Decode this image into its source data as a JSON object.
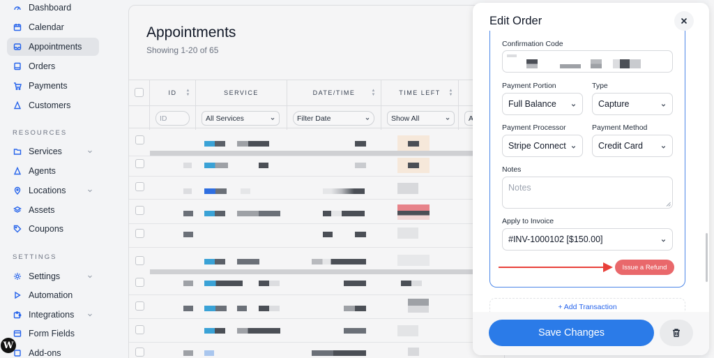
{
  "sidebar": {
    "items": [
      {
        "label": "Dashboard",
        "icon": "dashboard-icon"
      },
      {
        "label": "Calendar",
        "icon": "calendar-icon"
      },
      {
        "label": "Appointments",
        "icon": "inbox-icon",
        "active": true
      },
      {
        "label": "Orders",
        "icon": "orders-icon"
      },
      {
        "label": "Payments",
        "icon": "cart-icon"
      },
      {
        "label": "Customers",
        "icon": "user-icon"
      }
    ],
    "resources_title": "RESOURCES",
    "resources": [
      {
        "label": "Services",
        "icon": "folder-icon",
        "has_children": true
      },
      {
        "label": "Agents",
        "icon": "user-icon"
      },
      {
        "label": "Locations",
        "icon": "location-pin-icon",
        "has_children": true
      },
      {
        "label": "Assets",
        "icon": "layers-icon"
      },
      {
        "label": "Coupons",
        "icon": "tag-icon"
      }
    ],
    "settings_title": "SETTINGS",
    "settings": [
      {
        "label": "Settings",
        "icon": "gear-icon",
        "has_children": true
      },
      {
        "label": "Automation",
        "icon": "play-icon"
      },
      {
        "label": "Integrations",
        "icon": "puzzle-icon",
        "has_children": true
      },
      {
        "label": "Form Fields",
        "icon": "form-icon"
      },
      {
        "label": "Add-ons",
        "icon": "addons-icon"
      }
    ]
  },
  "main": {
    "title": "Appointments",
    "subtitle": "Showing 1-20 of 65",
    "columns": [
      "ID",
      "SERVICE",
      "DATE/TIME",
      "TIME LEFT"
    ],
    "filters": {
      "id_placeholder": "ID",
      "service": "All Services",
      "date": "Filter Date",
      "time_left": "Show All",
      "extra": "A"
    }
  },
  "modal": {
    "title": "Edit Order",
    "confirmation_label": "Confirmation Code",
    "payment_portion_label": "Payment Portion",
    "payment_portion_value": "Full Balance",
    "type_label": "Type",
    "type_value": "Capture",
    "processor_label": "Payment Processor",
    "processor_value": "Stripe Connect",
    "method_label": "Payment Method",
    "method_value": "Credit Card",
    "notes_label": "Notes",
    "notes_placeholder": "Notes",
    "invoice_label": "Apply to Invoice",
    "invoice_value": "#INV-1000102 [$150.00]",
    "refund_label": "Issue a Refund",
    "add_transaction_label": "+ Add Transaction",
    "save_label": "Save Changes"
  },
  "colors": {
    "accent": "#2b7be8",
    "refund": "#e9686b",
    "arrow": "#e8403a"
  }
}
